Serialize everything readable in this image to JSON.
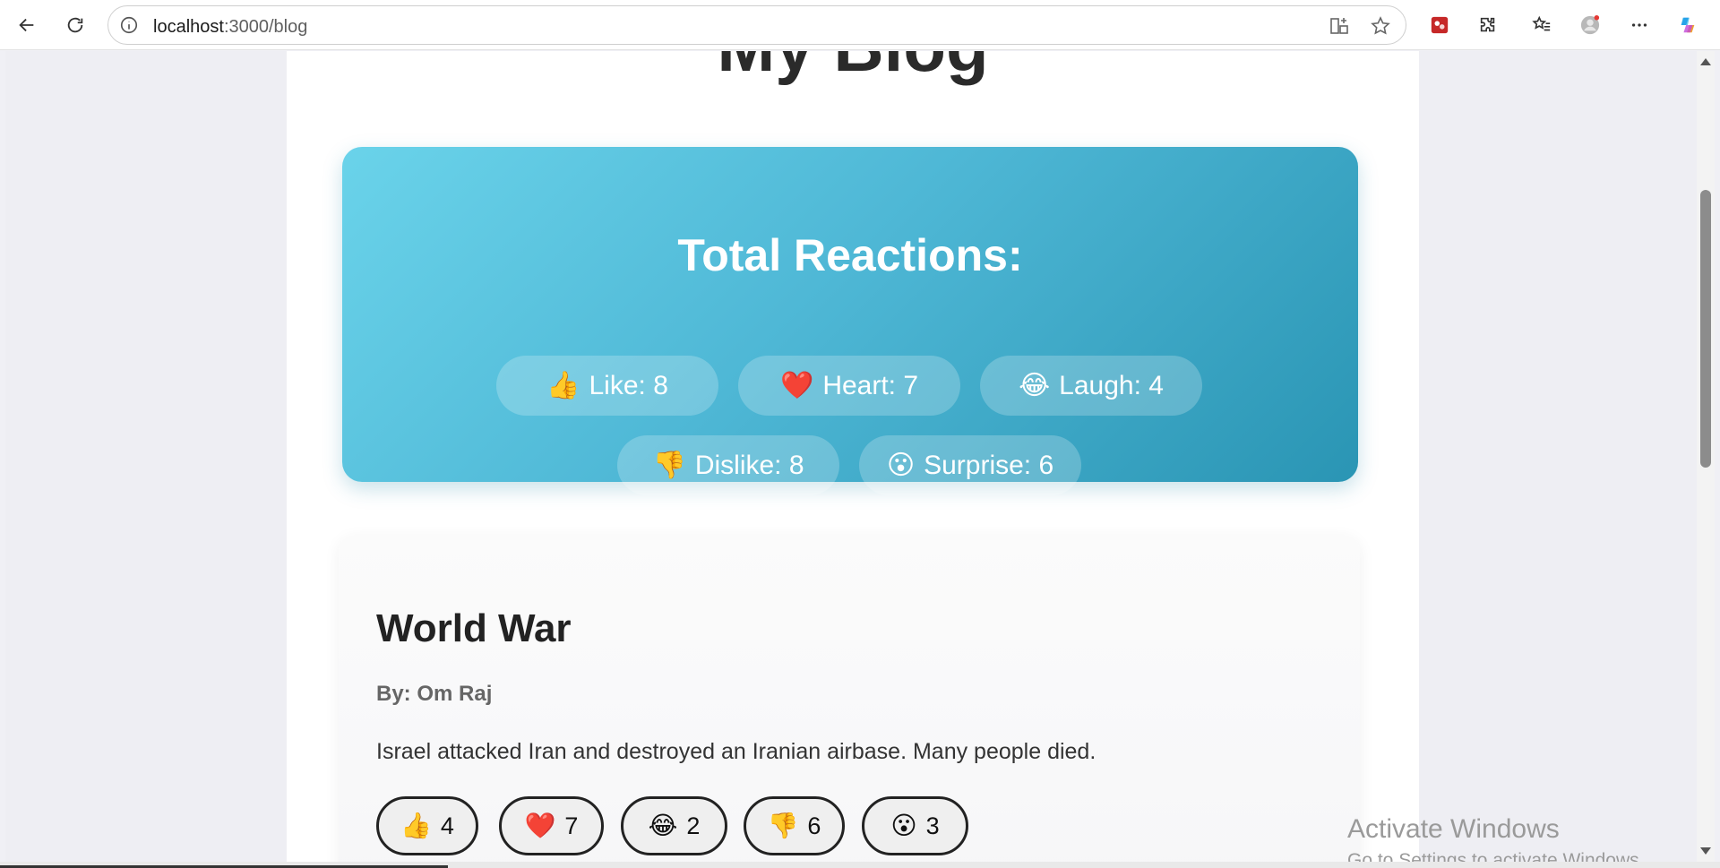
{
  "browser": {
    "url_host": "localhost",
    "url_path": ":3000/blog"
  },
  "page": {
    "title": "My Blog"
  },
  "total_reactions": {
    "title": "Total Reactions:",
    "items": [
      {
        "emoji": "👍",
        "label": "Like: 8"
      },
      {
        "emoji": "❤️",
        "label": "Heart: 7"
      },
      {
        "emoji": "😂",
        "label": "Laugh: 4"
      },
      {
        "emoji": "👎",
        "label": "Dislike: 8"
      },
      {
        "emoji": "😮",
        "label": "Surprise: 6"
      }
    ]
  },
  "post": {
    "title": "World War",
    "author": "By: Om Raj",
    "body": "Israel attacked Iran and destroyed an Iranian airbase. Many people died.",
    "reactions": [
      {
        "emoji": "👍",
        "count": "4"
      },
      {
        "emoji": "❤️",
        "count": "7"
      },
      {
        "emoji": "😂",
        "count": "2"
      },
      {
        "emoji": "👎",
        "count": "6"
      },
      {
        "emoji": "😮",
        "count": "3"
      }
    ]
  },
  "watermark": {
    "line1": "Activate Windows",
    "line2": "Go to Settings to activate Windows."
  },
  "colors": {
    "panel_start": "#6ad3ea",
    "panel_end": "#2a95b4"
  }
}
